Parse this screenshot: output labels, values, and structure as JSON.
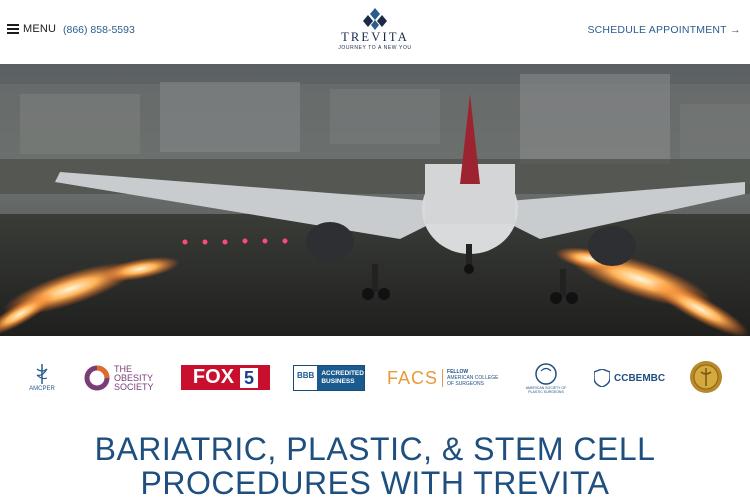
{
  "header": {
    "menu_label": "MENU",
    "phone": "(866) 858-5593",
    "logo": {
      "name": "TREVITA",
      "tagline": "JOURNEY TO A NEW YOU"
    },
    "schedule_label": "SCHEDULE APPOINTMENT",
    "schedule_arrow": "→"
  },
  "badges": {
    "asmbs": {
      "name": "AMCPER",
      "sub": ""
    },
    "obesity": {
      "line1": "THE",
      "line2": "OBESITY",
      "line3": "SOCIETY"
    },
    "fox": {
      "text": "FOX",
      "num": "5"
    },
    "bbb": {
      "line1": "ACCREDITED",
      "line2": "BUSINESS",
      "mark": "BBB"
    },
    "facs": {
      "abbr": "FACS",
      "line1": "FELLOW",
      "line2": "AMERICAN COLLEGE",
      "line3": "OF SURGEONS"
    },
    "asps": {
      "line1": "AMERICAN SOCIETY OF",
      "line2": "PLASTIC SURGEONS"
    },
    "ccbembc": {
      "text": "CCBEMBC"
    }
  },
  "main": {
    "title_line1": "BARIATRIC, PLASTIC, & STEM CELL",
    "title_line2": "PROCEDURES WITH TREVITA"
  },
  "colors": {
    "brand_blue": "#2a5c8f",
    "title_blue": "#1f4f7e",
    "logo_navy": "#1a2b4a"
  }
}
